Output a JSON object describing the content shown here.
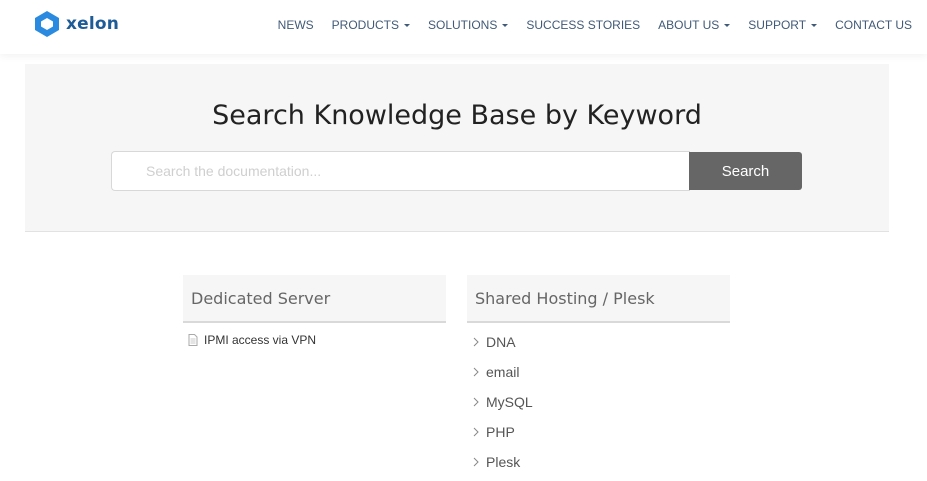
{
  "header": {
    "logo_text": "xelon",
    "nav": [
      {
        "label": "NEWS",
        "dropdown": false
      },
      {
        "label": "PRODUCTS",
        "dropdown": true
      },
      {
        "label": "SOLUTIONS",
        "dropdown": true
      },
      {
        "label": "SUCCESS STORIES",
        "dropdown": false
      },
      {
        "label": "ABOUT US",
        "dropdown": true
      },
      {
        "label": "SUPPORT",
        "dropdown": true
      },
      {
        "label": "CONTACT US",
        "dropdown": false
      }
    ]
  },
  "hero": {
    "title": "Search Knowledge Base by Keyword",
    "search_placeholder": "Search the documentation...",
    "search_value": "",
    "search_button": "Search"
  },
  "categories": [
    {
      "title": "Dedicated Server",
      "items": [
        "IPMI access via VPN"
      ]
    },
    {
      "title": "Shared Hosting / Plesk",
      "items": [
        "DNA",
        "email",
        "MySQL",
        "PHP",
        "Plesk"
      ]
    }
  ],
  "colors": {
    "brand": "#1d5c96",
    "button": "#666666",
    "hero_bg": "#f6f6f6"
  }
}
